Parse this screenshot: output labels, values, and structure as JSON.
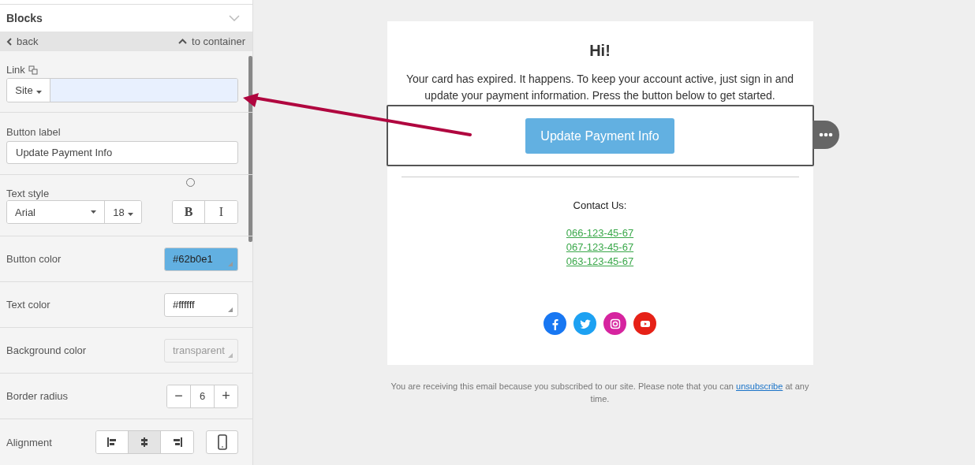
{
  "panel": {
    "title": "Blocks",
    "back": "back",
    "to_container": "to container",
    "link": {
      "label": "Link",
      "type": "Site"
    },
    "button_label": {
      "label": "Button label",
      "value": "Update Payment Info"
    },
    "text_style": {
      "label": "Text style",
      "font": "Arial",
      "size": "18",
      "bold": "B",
      "italic": "I"
    },
    "colors": [
      {
        "label": "Button color",
        "value": "#62b0e1",
        "color": "#62b0e1",
        "disabled": false
      },
      {
        "label": "Text color",
        "value": "#ffffff",
        "color": "#ffffff",
        "disabled": false
      },
      {
        "label": "Background color",
        "value": "transparent",
        "disabled": true
      }
    ],
    "border_radius": {
      "label": "Border radius",
      "value": "6",
      "minus": "−",
      "plus": "+"
    },
    "alignment": {
      "label": "Alignment",
      "options": [
        {
          "kind": "left",
          "selected": false
        },
        {
          "kind": "center",
          "selected": true
        },
        {
          "kind": "right",
          "selected": false
        }
      ]
    }
  },
  "email": {
    "heading": "Hi!",
    "body": "Your card has expired. It happens. To keep your account active, just sign in and update your payment information. Press the button below to get started.",
    "button": "Update Payment Info",
    "contact_title": "Contact Us:",
    "phones": [
      "066-123-45-67",
      "067-123-45-67",
      "063-123-45-67"
    ],
    "social": [
      {
        "kind": "facebook",
        "color": "#1877f2"
      },
      {
        "kind": "twitter",
        "color": "#1da1f2"
      },
      {
        "kind": "instagram",
        "color": "#d6249f"
      },
      {
        "kind": "youtube",
        "color": "#e62117"
      }
    ],
    "footer": {
      "before": "You are receiving this email because you subscribed to our site. Please note that you can ",
      "link": "unsubscribe",
      "after": " at any time."
    }
  }
}
